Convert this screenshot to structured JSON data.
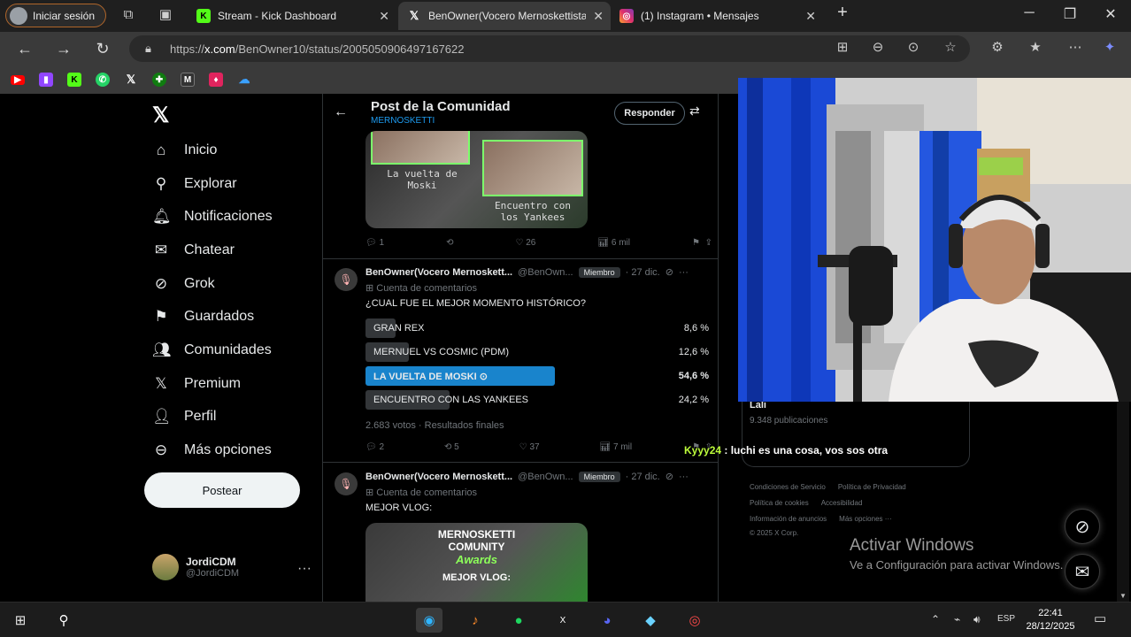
{
  "browser": {
    "signin_label": "Iniciar sesión",
    "tabs": [
      {
        "title": "Stream - Kick Dashboard",
        "icon": "kick-icon"
      },
      {
        "title": "BenOwner(Vocero Mernoskettista",
        "icon": "x-icon"
      },
      {
        "title": "(1) Instagram • Mensajes",
        "icon": "instagram-icon"
      }
    ],
    "url_prefix": "https://",
    "url_host": "x.com",
    "url_path": "/BenOwner10/status/2005050906497167622",
    "bookmarks": [
      "youtube-icon",
      "twitch-icon",
      "kick-icon",
      "whatsapp-icon",
      "x-icon",
      "xbox-icon",
      "m-icon",
      "bookmark-icon",
      "cloud-icon"
    ]
  },
  "nav": {
    "items": [
      {
        "label": "Inicio",
        "icon": "home-icon"
      },
      {
        "label": "Explorar",
        "icon": "search-icon"
      },
      {
        "label": "Notificaciones",
        "icon": "bell-icon"
      },
      {
        "label": "Chatear",
        "icon": "mail-icon"
      },
      {
        "label": "Grok",
        "icon": "grok-icon"
      },
      {
        "label": "Guardados",
        "icon": "bookmark-icon"
      },
      {
        "label": "Comunidades",
        "icon": "people-icon"
      },
      {
        "label": "Premium",
        "icon": "x-icon"
      },
      {
        "label": "Perfil",
        "icon": "user-icon"
      },
      {
        "label": "Más opciones",
        "icon": "more-icon"
      }
    ],
    "post_label": "Postear",
    "account_name": "JordiCDM",
    "account_handle": "@JordiCDM"
  },
  "feed": {
    "header_title": "Post de la Comunidad",
    "header_sub": "MERNOSKETTI",
    "reply_label": "Responder",
    "top_media": {
      "caption_left": "La vuelta de Moski",
      "caption_right": "Encuentro con los Yankees"
    },
    "top_actions": {
      "replies": "1",
      "reposts": "",
      "likes": "26",
      "views": "6 mil"
    },
    "poll_tweet": {
      "name": "BenOwner(Vocero Mernoskett...",
      "handle": "@BenOwn...",
      "badge": "Miembro",
      "date": "· 27 dic.",
      "context": "Cuenta de comentarios",
      "text": "¿CUAL FUE EL MEJOR MOMENTO HISTÓRICO?",
      "options": [
        {
          "label": "GRAN REX",
          "pct": "8,6 %",
          "value": 8.6,
          "winner": false
        },
        {
          "label": "MERNUEL VS COSMIC (PDM)",
          "pct": "12,6 %",
          "value": 12.6,
          "winner": false
        },
        {
          "label": "LA VUELTA DE MOSKI",
          "pct": "54,6 %",
          "value": 54.6,
          "winner": true
        },
        {
          "label": "ENCUENTRO CON LAS YANKEES",
          "pct": "24,2 %",
          "value": 24.2,
          "winner": false
        }
      ],
      "votes": "2.683 votos · Resultados finales",
      "actions": {
        "replies": "2",
        "reposts": "5",
        "likes": "37",
        "views": "7 mil"
      }
    },
    "vlog_tweet": {
      "name": "BenOwner(Vocero Mernoskett...",
      "handle": "@BenOwn...",
      "badge": "Miembro",
      "date": "· 27 dic.",
      "context": "Cuenta de comentarios",
      "text": "MEJOR VLOG:",
      "media_line1": "MERNOSKETTI",
      "media_line2": "COMUNITY",
      "media_line3": "Awards",
      "media_line4": "MEJOR VLOG:"
    }
  },
  "sidebar": {
    "trend_name": "Lali",
    "trend_count": "9.348 publicaciones",
    "footer_row1": [
      "Condiciones de Servicio",
      "Política de Privacidad"
    ],
    "footer_row2": [
      "Política de cookies",
      "Accesibilidad"
    ],
    "footer_row3": [
      "Información de anuncios",
      "Más opciones ···"
    ],
    "copyright": "© 2025 X Corp.",
    "activate_title": "Activar Windows",
    "activate_sub": "Ve a Configuración para activar Windows."
  },
  "overlay_chat": {
    "user": "Kyyy24",
    "message": " : luchi es una cosa, vos sos otra"
  },
  "taskbar": {
    "lang": "ESP",
    "time": "22:41",
    "date": "28/12/2025"
  },
  "colors": {
    "accent": "#1d9bf0",
    "kick": "#53fc18",
    "chat_user": "#bdfc3b"
  }
}
